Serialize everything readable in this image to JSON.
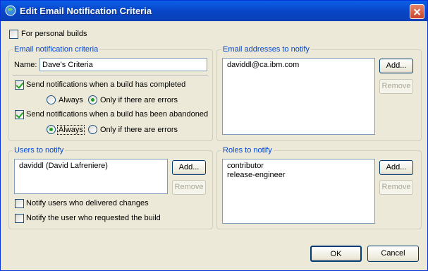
{
  "dialog": {
    "title": "Edit Email Notification Criteria"
  },
  "personal_builds": {
    "label": "For personal builds",
    "checked": false
  },
  "criteria": {
    "group_label": "Email notification criteria",
    "name_label": "Name:",
    "name_value": "Dave's Criteria",
    "completed": {
      "label": "Send notifications when a build has completed",
      "checked": true,
      "always_label": "Always",
      "errors_label": "Only if there are errors",
      "selected": "errors"
    },
    "abandoned": {
      "label": "Send notifications when a build has been abandoned",
      "checked": true,
      "always_label": "Always",
      "errors_label": "Only if there are errors",
      "selected": "always"
    }
  },
  "email": {
    "group_label": "Email addresses to notify",
    "items": [
      "daviddl@ca.ibm.com"
    ],
    "add_label": "Add...",
    "remove_label": "Remove"
  },
  "users": {
    "group_label": "Users to notify",
    "items": [
      "daviddl (David Lafreniere)"
    ],
    "add_label": "Add...",
    "remove_label": "Remove",
    "delivered_label": "Notify users who delivered changes",
    "delivered_checked": false,
    "requested_label": "Notify the user who requested the build",
    "requested_checked": false
  },
  "roles": {
    "group_label": "Roles to notify",
    "items": [
      "contributor",
      "release-engineer"
    ],
    "add_label": "Add...",
    "remove_label": "Remove"
  },
  "footer": {
    "ok_label": "OK",
    "cancel_label": "Cancel"
  }
}
